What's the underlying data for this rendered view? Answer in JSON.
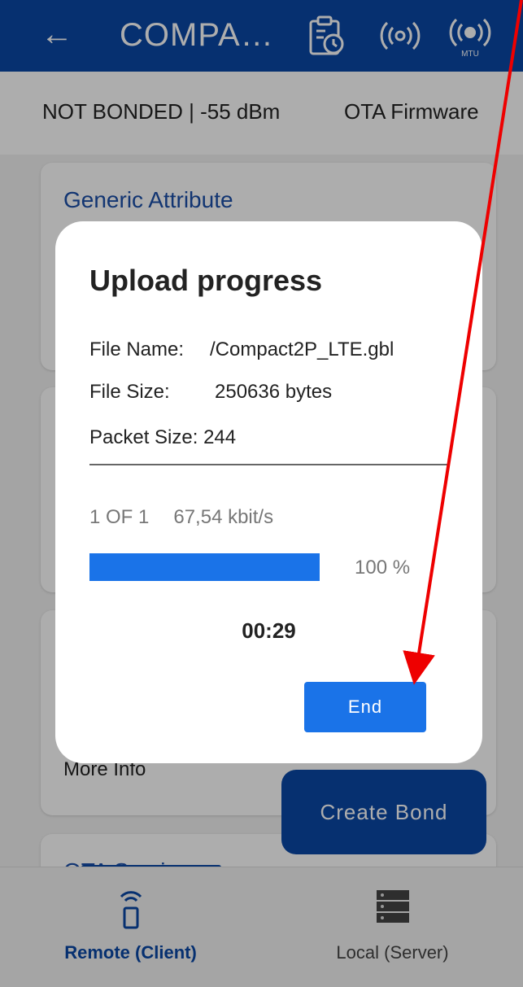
{
  "appbar": {
    "back_icon": "arrow-left-icon",
    "title": "COMPA…",
    "icons": [
      "clipboard-clock-icon",
      "broadcast-icon",
      "mtu-broadcast-icon"
    ],
    "mtu_label": "MTU"
  },
  "status": {
    "connection": "NOT BONDED | -55 dBm",
    "ota": "OTA Firmware"
  },
  "cards": [
    {
      "title": "Generic Attribute"
    },
    {
      "title": ""
    },
    {
      "title": ""
    }
  ],
  "more_info": "More Info",
  "ota_service": "OTA Service",
  "fab_label": "Create Bond",
  "bottom_nav": {
    "items": [
      {
        "label": "Remote (Client)",
        "icon": "bluetooth-remote-icon",
        "active": true
      },
      {
        "label": "Local (Server)",
        "icon": "server-icon",
        "active": false
      }
    ]
  },
  "dialog": {
    "title": "Upload progress",
    "file_name_label": "File Name:",
    "file_name": "/Compact2P_LTE.gbl",
    "file_size_label": "File Size:",
    "file_size": "250636 bytes",
    "packet_size_label": "Packet Size:",
    "packet_size": "244",
    "progress_count": "1 OF 1",
    "rate": "67,54 kbit/s",
    "percent_text": "100 %",
    "progress": 1.0,
    "time": "00:29",
    "end_label": "End"
  },
  "colors": {
    "primary": "#0a47a6",
    "accent": "#1a73e8",
    "annotation": "#ee0000"
  }
}
